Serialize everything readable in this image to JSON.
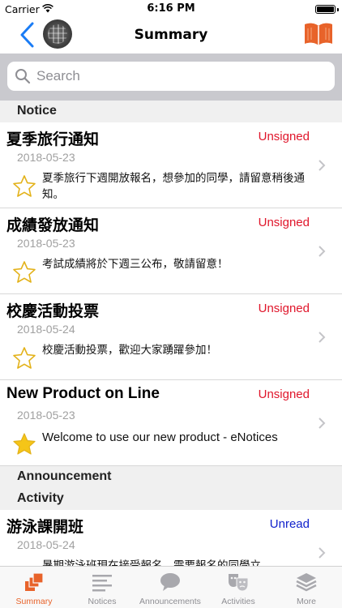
{
  "status_bar": {
    "carrier": "Carrier",
    "time": "6:16 PM",
    "battery_percent": 100
  },
  "nav": {
    "title": "Summary"
  },
  "search": {
    "placeholder": "Search"
  },
  "sections": [
    {
      "header": "Notice",
      "items": [
        {
          "title": "夏季旅行通知",
          "status": "Unsigned",
          "date": "2018-05-23",
          "body": "夏季旅行下週開放報名，想參加的同學，請留意稍後通知。",
          "starred": false
        },
        {
          "title": "成績發放通知",
          "status": "Unsigned",
          "date": "2018-05-23",
          "body": "考試成績將於下週三公布，敬請留意！",
          "starred": false
        },
        {
          "title": "校慶活動投票",
          "status": "Unsigned",
          "date": "2018-05-24",
          "body": "校慶活動投票，歡迎大家踴躍參加！",
          "starred": false
        },
        {
          "title": "New Product on Line",
          "status": "Unsigned",
          "date": "2018-05-23",
          "body": "Welcome to use our new product - eNotices",
          "starred": true
        }
      ]
    },
    {
      "header": "Announcement",
      "items": []
    },
    {
      "header": "Activity",
      "items": [
        {
          "title": "游泳課開班",
          "status": "Unread",
          "date": "2018-05-24",
          "body": "暑期游泳班現在接受報名，需要報名的同學立",
          "starred": false
        }
      ]
    }
  ],
  "tabs": [
    {
      "label": "Summary",
      "icon": "summary-stack-icon",
      "active": true
    },
    {
      "label": "Notices",
      "icon": "notices-list-icon",
      "active": false
    },
    {
      "label": "Announcements",
      "icon": "announcements-bubble-icon",
      "active": false
    },
    {
      "label": "Activities",
      "icon": "activities-masks-icon",
      "active": false
    },
    {
      "label": "More",
      "icon": "more-layers-icon",
      "active": false
    }
  ],
  "colors": {
    "accent": "#e8632a",
    "unsigned": "#e0162b",
    "unread": "#1122cc",
    "star_fill": "#f5c518",
    "back_blue": "#1a7cf5"
  }
}
